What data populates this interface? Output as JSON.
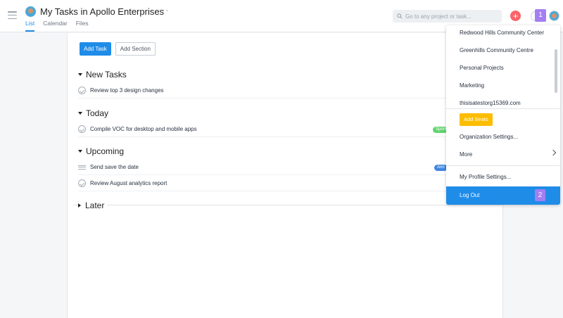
{
  "header": {
    "title": "My Tasks in Apollo Enterprises",
    "more": "···",
    "tabs": [
      {
        "label": "List"
      },
      {
        "label": "Calendar"
      },
      {
        "label": "Files"
      }
    ],
    "search_placeholder": "Go to any project or task...",
    "add": "+",
    "marker": "1"
  },
  "toolbar": {
    "add_task": "Add Task",
    "add_section": "Add Section"
  },
  "sections": [
    {
      "name": "New Tasks",
      "tasks": [
        "Review top 3 design changes"
      ]
    },
    {
      "name": "Today",
      "tasks": [
        "Compile VOC for desktop and mobile apps"
      ],
      "tag": "Sprint"
    },
    {
      "name": "Upcoming",
      "tasks": [
        "Send save the date",
        "Review August analytics report"
      ],
      "tag": "Ann"
    },
    {
      "name": "Later"
    }
  ],
  "colors": {
    "accent": "#1f8ce8",
    "add_button": "#fc636b",
    "add_seats": "#fcbd01",
    "marker": "#a37ff2",
    "tag_green": "#62d26f",
    "tag_blue": "#4186e0"
  },
  "dropdown": {
    "workspaces": [
      "Redwood Hills Community Center",
      "Greenhills Community Centre",
      "Personal Projects",
      "Marketing",
      "thisisatestorg15369.com"
    ],
    "add_seats": "Add Seats",
    "org_settings": "Organization Settings...",
    "more": "More",
    "profile_settings": "My Profile Settings...",
    "logout": "Log Out",
    "marker": "2"
  }
}
